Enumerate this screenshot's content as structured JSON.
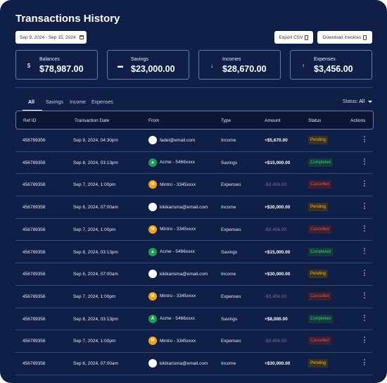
{
  "title": "Transactions History",
  "date_range": "Sep 9, 2024 - Sep 15, 2024",
  "buttons": {
    "export_csv": "Export CSV",
    "download_invoices": "Download Invoices"
  },
  "cards": [
    {
      "label": "Balances",
      "value": "$78,987.00",
      "icon": "dollar-icon"
    },
    {
      "label": "Savings",
      "value": "$23,000.00",
      "icon": "wallet-icon"
    },
    {
      "label": "Incomes",
      "value": "$28,670.00",
      "icon": "arrow-down-icon"
    },
    {
      "label": "Expenses",
      "value": "$3,456.00",
      "icon": "arrow-up-icon"
    }
  ],
  "tabs": [
    "All",
    "Savings",
    "Income",
    "Expenses"
  ],
  "status_filter": {
    "label": "Status:",
    "value": "All"
  },
  "columns": [
    "Ref ID",
    "Transaction Date",
    "From",
    "Type",
    "Amount",
    "Status",
    "Actions"
  ],
  "rows": [
    {
      "ref": "456789356",
      "date": "Sep 9, 2024, 04:30pm",
      "from": "fadel@email.com",
      "avatar": "white",
      "avatar_letter": "",
      "type": "Income",
      "amount": "+$5,670.00",
      "negative": false,
      "status": "Pending"
    },
    {
      "ref": "456789356",
      "date": "Sep 8, 2024, 03:13pm",
      "from": "Acme - 5466xxxx",
      "avatar": "green",
      "avatar_letter": "▲",
      "type": "Savings",
      "amount": "+$15,000.00",
      "negative": false,
      "status": "Completed"
    },
    {
      "ref": "456789356",
      "date": "Sep 7, 2024, 1:00pm",
      "from": "Mintro - 3345xxxx",
      "avatar": "orange",
      "avatar_letter": "M",
      "type": "Expenses",
      "amount": "-$3,456.00",
      "negative": true,
      "status": "Cancelled"
    },
    {
      "ref": "456789356",
      "date": "Sep 6, 2024, 07:00am",
      "from": "kikikarisma@email.com",
      "avatar": "white",
      "avatar_letter": "",
      "type": "Income",
      "amount": "+$30,000.00",
      "negative": false,
      "status": "Pending"
    },
    {
      "ref": "456789356",
      "date": "Sep 7, 2024, 1:00pm",
      "from": "Mintro - 3345xxxx",
      "avatar": "orange",
      "avatar_letter": "M",
      "type": "Expenses",
      "amount": "-$3,456.00",
      "negative": true,
      "status": "Cancelled"
    },
    {
      "ref": "456789356",
      "date": "Sep 8, 2024, 03:13pm",
      "from": "Acme - 5466xxxx",
      "avatar": "green",
      "avatar_letter": "▲",
      "type": "Savings",
      "amount": "+$15,000.00",
      "negative": false,
      "status": "Completed"
    },
    {
      "ref": "456789356",
      "date": "Sep 6, 2024, 07:00am",
      "from": "kikikarisma@email.com",
      "avatar": "white",
      "avatar_letter": "",
      "type": "Income",
      "amount": "+$30,000.00",
      "negative": false,
      "status": "Pending"
    },
    {
      "ref": "456789356",
      "date": "Sep 7, 2024, 1:00pm",
      "from": "Mintro - 3345xxxx",
      "avatar": "orange",
      "avatar_letter": "M",
      "type": "Expenses",
      "amount": "-$3,456.00",
      "negative": true,
      "status": "Cancelled"
    },
    {
      "ref": "456789356",
      "date": "Sep 8, 2024, 03:13pm",
      "from": "Acme - 5466xxxx",
      "avatar": "green",
      "avatar_letter": "A",
      "type": "Savings",
      "amount": "+$8,000.00",
      "negative": false,
      "status": "Completed"
    },
    {
      "ref": "456789356",
      "date": "Sep 7, 2024, 1:00pm",
      "from": "Mintro - 3345xxxx",
      "avatar": "orange",
      "avatar_letter": "M",
      "type": "Expenses",
      "amount": "-$3,456.00",
      "negative": true,
      "status": "Cancelled"
    },
    {
      "ref": "456789356",
      "date": "Sep 6, 2024, 07:00am",
      "from": "kikikarisma@email.com",
      "avatar": "white",
      "avatar_letter": "",
      "type": "Income",
      "amount": "+$30,000.00",
      "negative": false,
      "status": "Pending"
    }
  ],
  "colors": {
    "background": "#0f1f47",
    "pending": "#f2b431",
    "completed": "#35d07f",
    "cancelled": "#e4505a"
  }
}
